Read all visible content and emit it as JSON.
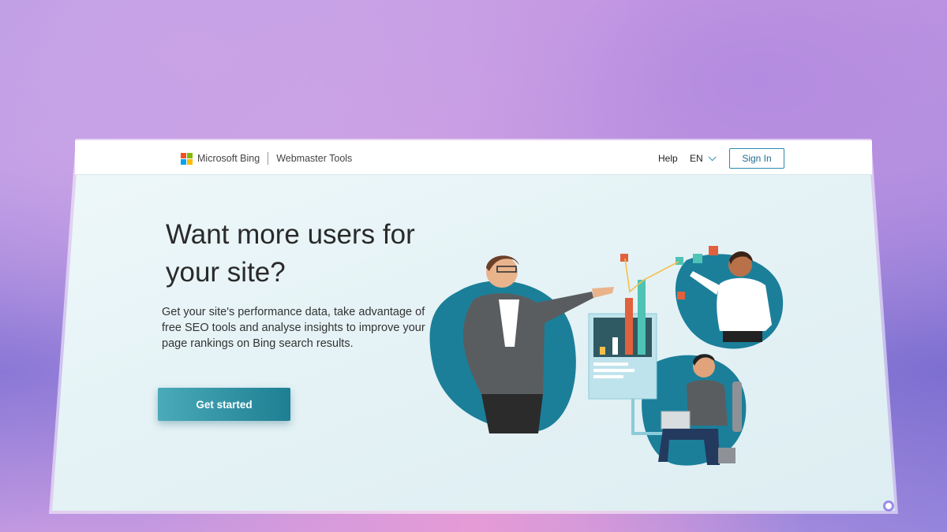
{
  "header": {
    "brand": "Microsoft Bing",
    "product": "Webmaster Tools",
    "help": "Help",
    "language": "EN",
    "sign_in": "Sign In"
  },
  "hero": {
    "headline": "Want more users for your site?",
    "description": "Get your site's performance data, take advantage of free SEO tools and analyse insights to improve your page rankings on Bing search results.",
    "cta": "Get started"
  },
  "colors": {
    "accent": "#1e7f93",
    "cta_gradient_start": "#4aaab8",
    "blob": "#1b7f9a"
  },
  "icons": {
    "logo": "microsoft-logo-icon",
    "language_dropdown": "chevron-down-icon",
    "corner": "copilot-icon"
  }
}
